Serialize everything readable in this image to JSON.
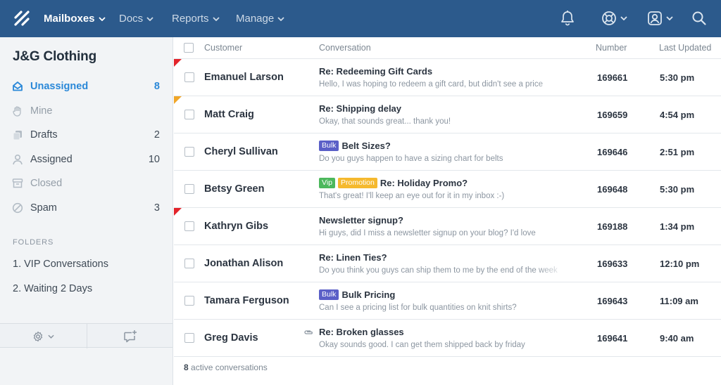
{
  "nav": {
    "items": [
      {
        "label": "Mailboxes",
        "active": true
      },
      {
        "label": "Docs"
      },
      {
        "label": "Reports"
      },
      {
        "label": "Manage"
      }
    ],
    "icons": [
      "bell-icon",
      "help-lifebuoy-icon",
      "user-profile-icon",
      "search-icon"
    ]
  },
  "sidebar": {
    "title": "J&G Clothing",
    "items": [
      {
        "label": "Unassigned",
        "count": "8",
        "icon": "inbox-icon",
        "active": true
      },
      {
        "label": "Mine",
        "count": "",
        "icon": "hand-icon"
      },
      {
        "label": "Drafts",
        "count": "2",
        "icon": "drafts-icon"
      },
      {
        "label": "Assigned",
        "count": "10",
        "icon": "person-icon"
      },
      {
        "label": "Closed",
        "count": "",
        "icon": "archive-icon"
      },
      {
        "label": "Spam",
        "count": "3",
        "icon": "spam-icon"
      }
    ],
    "folders_heading": "FOLDERS",
    "folders": [
      "1. VIP Conversations",
      "2. Waiting 2 Days"
    ]
  },
  "table": {
    "headers": {
      "customer": "Customer",
      "conversation": "Conversation",
      "number": "Number",
      "updated": "Last Updated"
    },
    "rows": [
      {
        "customer": "Emanuel Larson",
        "flag": "red",
        "tags": [],
        "subject": "Re: Redeeming Gift Cards",
        "preview": "Hello, I was hoping to redeem a gift card, but didn't see a price",
        "number": "169661",
        "time": "5:30 pm"
      },
      {
        "customer": "Matt Craig",
        "flag": "orange",
        "tags": [],
        "subject": "Re: Shipping delay",
        "preview": "Okay, that sounds great... thank you!",
        "number": "169659",
        "time": "4:54 pm"
      },
      {
        "customer": "Cheryl Sullivan",
        "flag": "",
        "tags": [
          {
            "label": "Bulk",
            "color": "#5a5fc7"
          }
        ],
        "subject": "Belt Sizes?",
        "preview": "Do you guys happen to have a sizing chart for belts",
        "number": "169646",
        "time": "2:51 pm"
      },
      {
        "customer": "Betsy Green",
        "flag": "",
        "tags": [
          {
            "label": "Vip",
            "color": "#4cb85c"
          },
          {
            "label": "Promotion",
            "color": "#f5b92e"
          }
        ],
        "subject": "Re: Holiday Promo?",
        "preview": "That's great! I'll keep an eye out for it in my inbox :-)",
        "number": "169648",
        "time": "5:30 pm"
      },
      {
        "customer": "Kathryn Gibs",
        "flag": "red",
        "tags": [],
        "subject": "Newsletter signup?",
        "preview": "Hi guys, did I miss a newsletter signup on your blog? I'd love",
        "number": "169188",
        "time": "1:34 pm"
      },
      {
        "customer": "Jonathan Alison",
        "flag": "",
        "tags": [],
        "subject": "Re: Linen Ties?",
        "preview": "Do you think you guys can ship them to me by the end of the week",
        "number": "169633",
        "time": "12:10 pm"
      },
      {
        "customer": "Tamara Ferguson",
        "flag": "",
        "tags": [
          {
            "label": "Bulk",
            "color": "#5a5fc7"
          }
        ],
        "subject": "Bulk Pricing",
        "preview": "Can I see a pricing list for bulk quantities on knit shirts?",
        "number": "169643",
        "time": "11:09 am"
      },
      {
        "customer": "Greg Davis",
        "flag": "",
        "attachment": true,
        "tags": [],
        "subject": "Re: Broken glasses",
        "preview": "Okay sounds good. I can get them shipped back by friday",
        "number": "169641",
        "time": "9:40 am"
      }
    ]
  },
  "footer": {
    "count": "8",
    "text": "active conversations"
  },
  "colors": {
    "nav": "#2c5a8c",
    "accent": "#2a88d8",
    "flag_red": "#e3242b",
    "flag_orange": "#f0a629"
  }
}
